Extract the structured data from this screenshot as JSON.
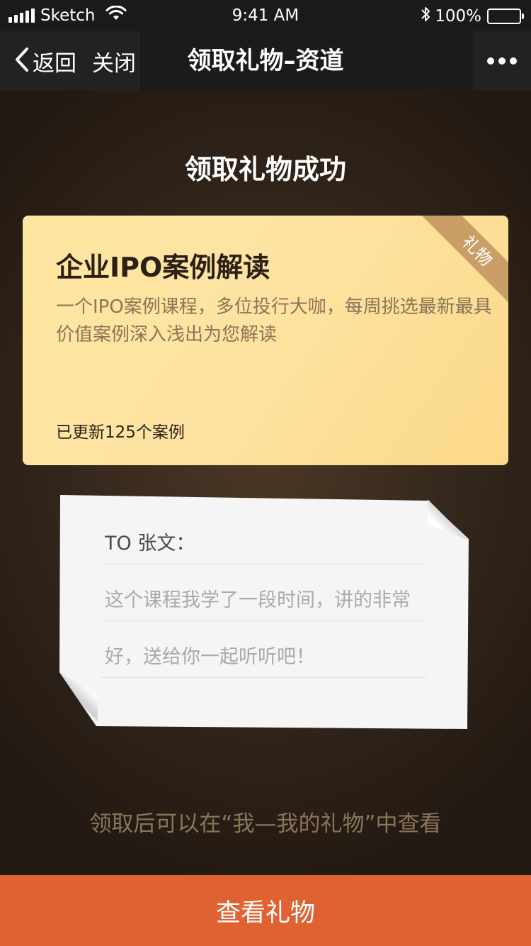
{
  "status_bar": {
    "carrier": "Sketch",
    "time": "9:41 AM",
    "battery_percent": "100%",
    "battery_level": 1.0,
    "icons": [
      "signal-icon",
      "wifi-icon",
      "bluetooth-icon",
      "battery-icon"
    ]
  },
  "nav": {
    "back_label": "返回",
    "close_label": "关闭",
    "title": "领取礼物–资道",
    "more_icon": "more-dots-icon"
  },
  "page": {
    "success_title": "领取礼物成功"
  },
  "gift_card": {
    "title": "企业IPO案例解读",
    "description": "一个IPO案例课程，多位投行大咖，每周挑选最新最具价值案例深入浅出为您解读",
    "update_count": "已更新125个案例",
    "ribbon_label": "礼物"
  },
  "note": {
    "to_line": "TO 张文：",
    "message_line1": "这个课程我学了一段时间，讲的非常",
    "message_line2": "好，送给你一起听听吧！"
  },
  "hint_text": "领取后可以在“我—我的礼物”中查看",
  "cta_label": "查看礼物",
  "colors": {
    "cta_background": "#e06230",
    "card_gold": "#fde3a2",
    "ribbon": "#c99e67",
    "hint_text": "#8a7559"
  }
}
